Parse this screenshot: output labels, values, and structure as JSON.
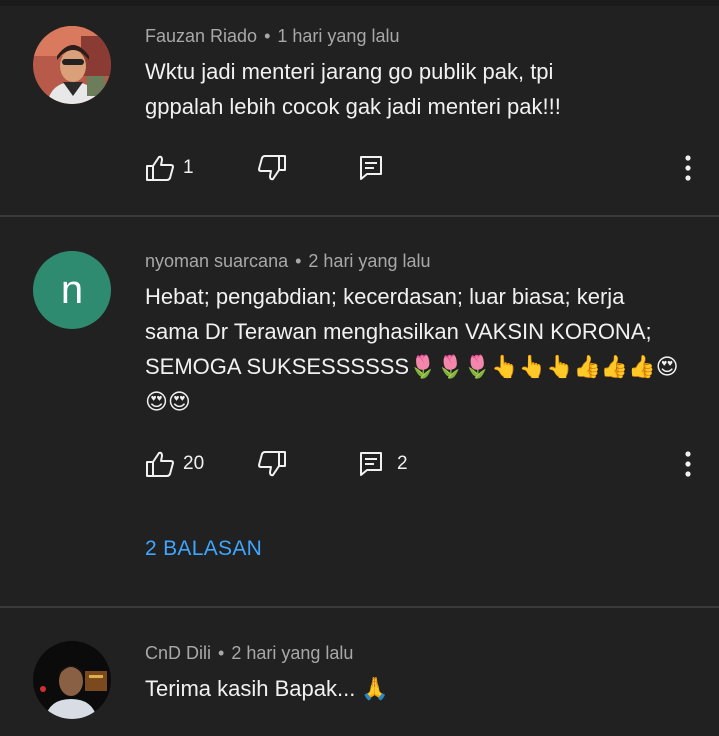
{
  "comments": [
    {
      "author": "Fauzan Riado",
      "time": "1 hari yang lalu",
      "text_lines": [
        "Wktu jadi menteri jarang go publik pak, tpi",
        "gppalah lebih cocok gak jadi menteri pak!!!"
      ],
      "likes": "1",
      "replies_count": "",
      "avatar": "photo-avatar"
    },
    {
      "author": "nyoman suarcana",
      "time": "2 hari yang lalu",
      "avatar_letter": "n",
      "text_lines": [
        "Hebat; pengabdian; kecerdasan; luar biasa;  kerja",
        "sama Dr Terawan menghasilkan VAKSIN KORONA;",
        "SEMOGA SUKSESSSSSS🌷🌷🌷👆👆👆👍👍👍😍",
        "😍😍"
      ],
      "likes": "20",
      "replies_count": "2",
      "replies_link": "2 BALASAN"
    },
    {
      "author": "CnD Dili",
      "time": "2 hari yang lalu",
      "text_lines": [
        "Terima kasih Bapak... 🙏"
      ],
      "avatar": "photo-avatar"
    }
  ],
  "separator": "•",
  "colors": {
    "background": "#212121",
    "meta_text": "#a8a8a8",
    "link": "#3ea6ff",
    "avatar_green": "#2e8b6f"
  }
}
